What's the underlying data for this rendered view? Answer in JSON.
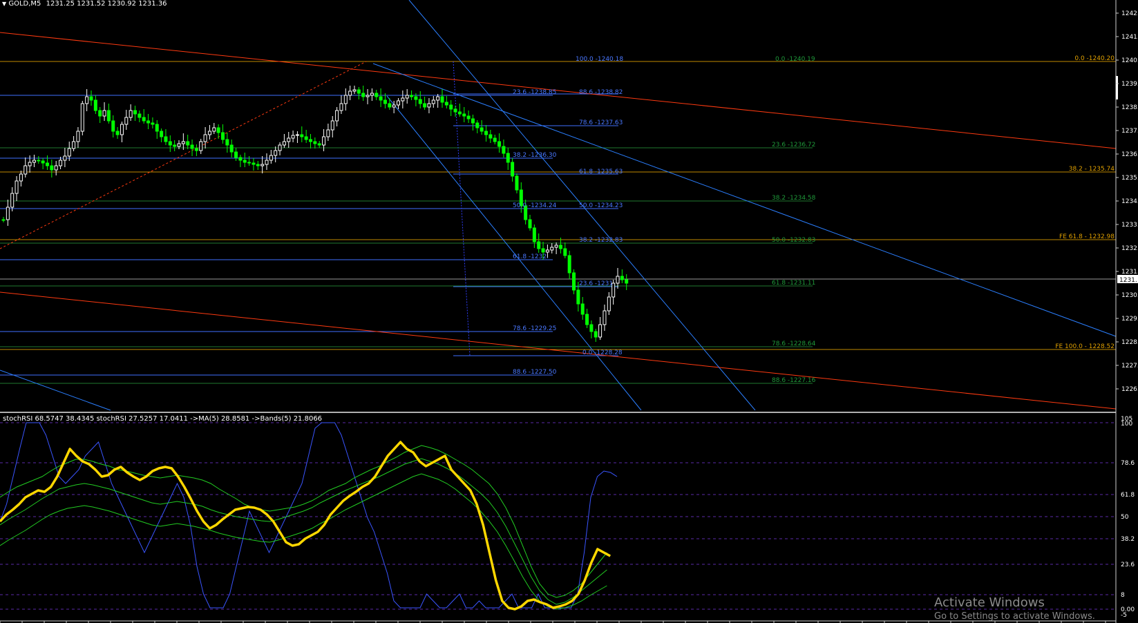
{
  "main_header": {
    "symbol": "GOLD,M5",
    "ohlc": "1231.25 1231.52 1230.92 1231.36"
  },
  "indicator_header": {
    "text": "stochRSI 68.5747 38.4345  stochRSI 27.5257 17.0411  ->MA(5) 28.8581  ->Bands(5) 21.8066"
  },
  "price_axis": {
    "ticks": [
      "1242.",
      "1241.",
      "1240.",
      "1239.",
      "1238.",
      "1237.",
      "1236.",
      "1235.",
      "1234.",
      "1233.",
      "1232.",
      "1231.",
      "1230.",
      "1229.",
      "1228.",
      "1227.",
      "1226."
    ],
    "current_price": "1231.",
    "price_0": "0.0 -1240.20",
    "price_38": "38.2 - 1235.74",
    "price_fe618": "FE 61.8 - 1232.98",
    "price_fe100": "FE 100.0 - 1228.52"
  },
  "indicator_axis": {
    "ticks": [
      "105",
      "100",
      "78.6",
      "61.8",
      "50",
      "38.2",
      "23.6",
      "8",
      "0.00",
      "-5"
    ]
  },
  "fib_blue": [
    "100.0 -1240.18",
    "88.6 -1238.82",
    "78.6 -1237.63",
    "61.8 -1235.63",
    "50.0 -1234.23",
    "38.2 -1232.83",
    "23.6 -1231",
    "0.0 -1228.28"
  ],
  "fib_left": [
    "23.6 -1238.85",
    "38.2 -1236.30",
    "50.0 -1234.24",
    "61.8 -1232.",
    "78.6 -1229.25",
    "88.6 -1227.50"
  ],
  "fib_green": [
    "0.0 -1240.19",
    "23.6 -1236.72",
    "38.2 -1234.58",
    "50.0 -1232.83",
    "61.8 -1231.11",
    "78.6 -1228.64",
    "88.6 -1227.16"
  ],
  "colors": {
    "background": "#000000",
    "bull_candle": "#ffffff",
    "bear_candle": "#00ff00",
    "fib_blue": "#3f6fff",
    "fib_green": "#1f9a3a",
    "fib_orange": "#e0a000",
    "trend_red": "#ff3a10",
    "trend_blue": "#2b7fff",
    "stoch_main": "#ffd700",
    "stoch_blue": "#4060ff",
    "stoch_green": "#22cc22"
  },
  "watermark": {
    "line1": "Activate Windows",
    "line2": "Go to Settings to activate Windows."
  }
}
